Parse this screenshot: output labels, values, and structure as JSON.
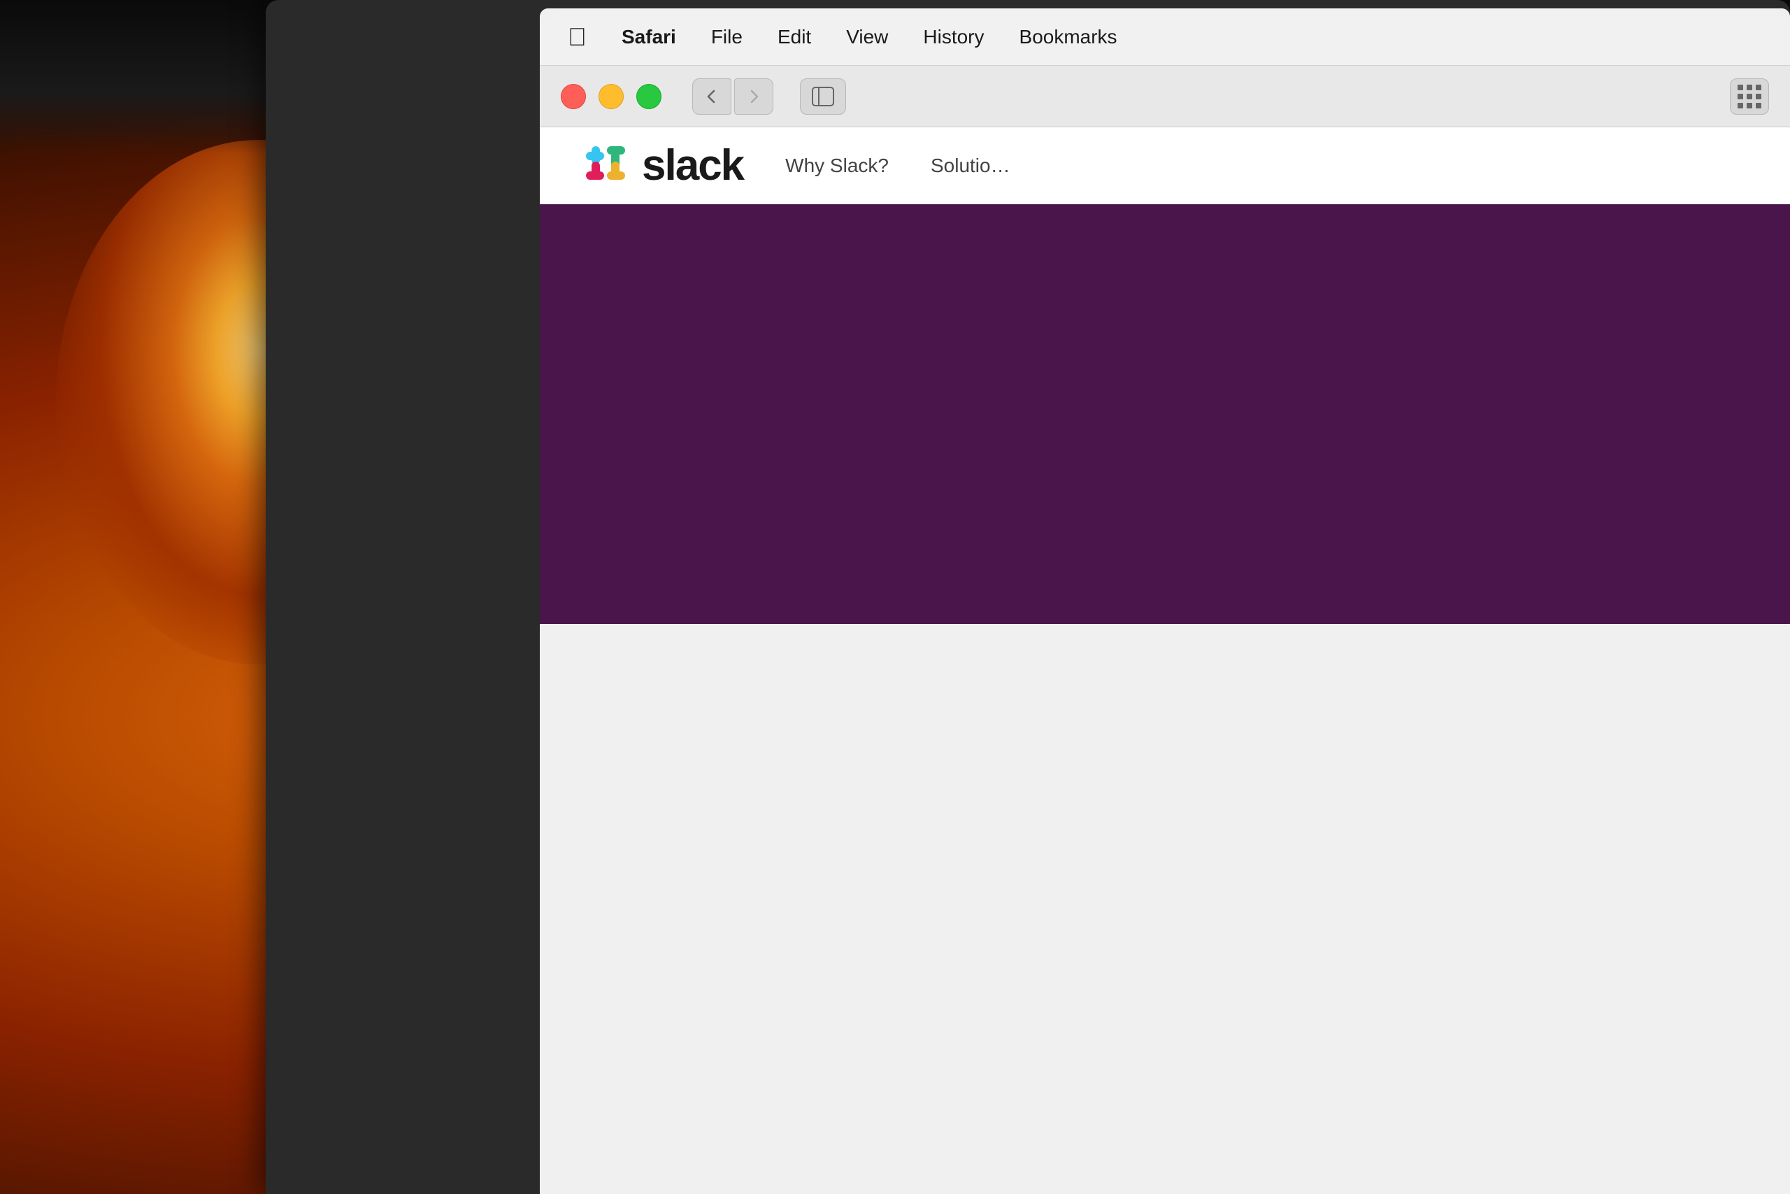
{
  "background": {
    "color": "#1a0a00"
  },
  "menubar": {
    "apple_label": "",
    "items": [
      {
        "id": "apple",
        "label": "",
        "bold": false
      },
      {
        "id": "safari",
        "label": "Safari",
        "bold": true
      },
      {
        "id": "file",
        "label": "File",
        "bold": false
      },
      {
        "id": "edit",
        "label": "Edit",
        "bold": false
      },
      {
        "id": "view",
        "label": "View",
        "bold": false
      },
      {
        "id": "history",
        "label": "History",
        "bold": false
      },
      {
        "id": "bookmarks",
        "label": "Bookmarks",
        "bold": false
      }
    ]
  },
  "browser": {
    "back_label": "‹",
    "forward_label": "›",
    "traffic_lights": {
      "red": "close",
      "yellow": "minimize",
      "green": "maximize"
    }
  },
  "slack_nav": {
    "logo_text": "slack",
    "nav_items": [
      {
        "id": "why-slack",
        "label": "Why Slack?"
      },
      {
        "id": "solutions",
        "label": "Solutio…"
      }
    ]
  },
  "hero": {
    "background_color": "#4a154b"
  }
}
